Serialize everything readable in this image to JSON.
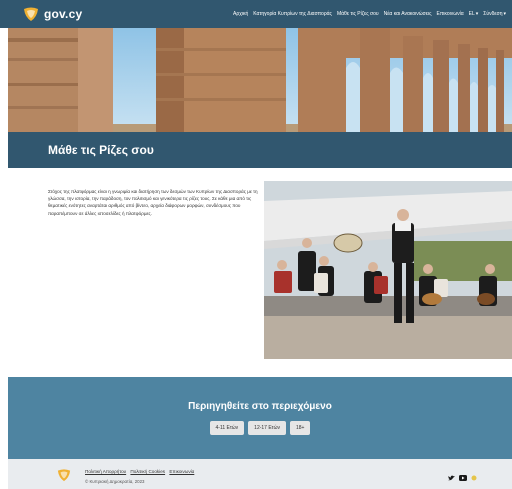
{
  "header": {
    "brand": "gov.cy",
    "nav": [
      {
        "label": "Αρχική"
      },
      {
        "label": "Κατηγορία Κυπρίων της Διασποράς"
      },
      {
        "label": "Μάθε τις Ρίζες σου"
      },
      {
        "label": "Νέα και Ανακοινώσεις"
      },
      {
        "label": "Επικοινωνία"
      }
    ],
    "language": "EL",
    "login": "Σύνδεση"
  },
  "page": {
    "title": "Μάθε τις Ρίζες σου",
    "intro": "Στόχος της πλατφόρμας είναι η γνωριμία και διατήρηση των δεσμών των Κυπρίων της Διασποράς με τη γλώσσα, την ιστορία, την παράδοση, τον πολιτισμό και γενικότερα τις ρίζες τους. Σε κάθε μια από τις θεματικές ενότητες αναρτάται αριθμός από βίντεο, αρχεία διάφορων μορφών, συνδέσμους που παραπέμπουν σε άλλες ιστοσελίδες ή πλατφόρμες."
  },
  "explore": {
    "heading": "Περιηγηθείτε στο περιεχόμενο",
    "buttons": [
      {
        "label": "4-11 Ετών"
      },
      {
        "label": "12-17 Ετών"
      },
      {
        "label": "18+"
      }
    ]
  },
  "footer": {
    "links": [
      {
        "label": "Πολιτική Απορρήτου"
      },
      {
        "label": "Πολιτική Cookies"
      },
      {
        "label": "Επικοινωνία"
      }
    ],
    "copyright": "© Κυπριακή Δημοκρατία, 2023",
    "social": [
      "twitter-icon",
      "youtube-icon",
      "other-icon"
    ]
  },
  "colors": {
    "header_bg": "#31576f",
    "explore_bg": "#4e84a1",
    "footer_bg": "#e9ecef",
    "accent": "#f0b133"
  }
}
